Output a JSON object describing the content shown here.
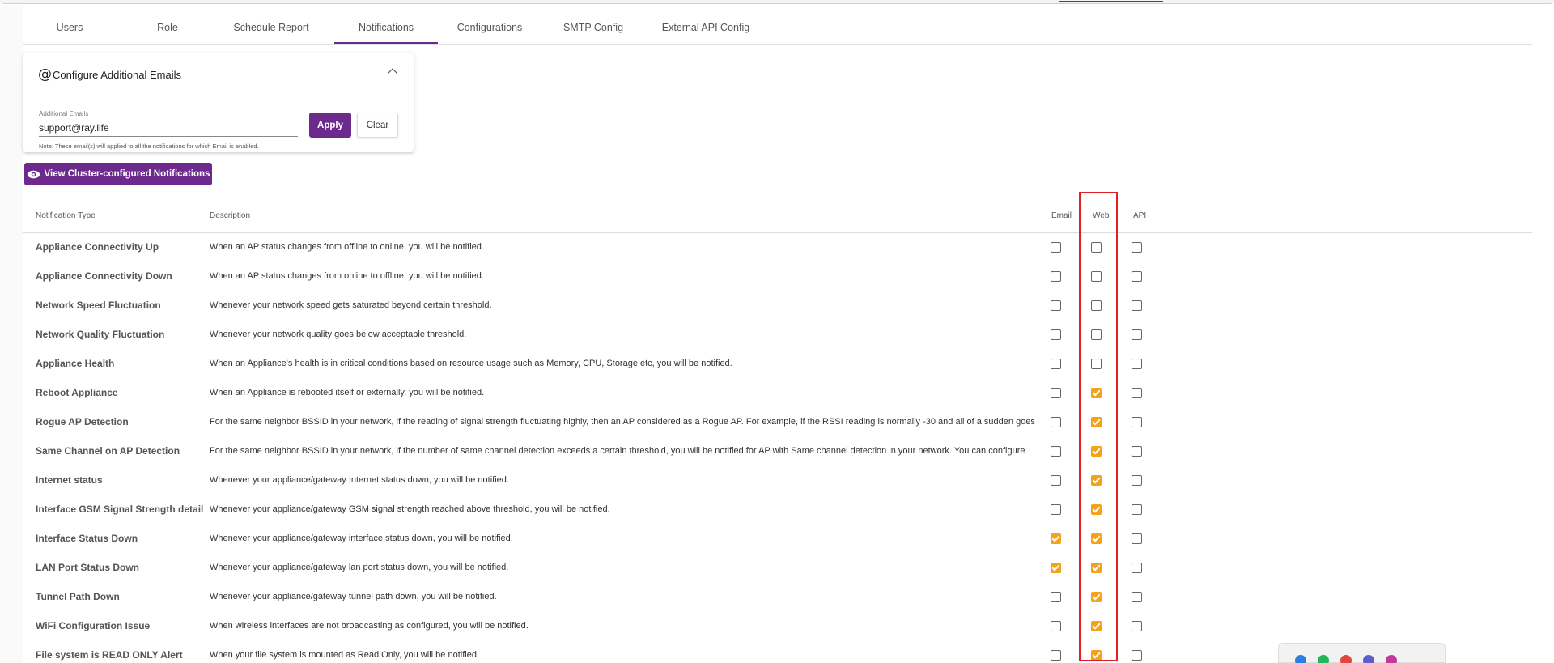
{
  "tabs": [
    {
      "label": "Users",
      "active": false
    },
    {
      "label": "Role",
      "active": false
    },
    {
      "label": "Schedule Report",
      "active": false
    },
    {
      "label": "Notifications",
      "active": true
    },
    {
      "label": "Configurations",
      "active": false
    },
    {
      "label": "SMTP Config",
      "active": false
    },
    {
      "label": "External API Config",
      "active": false
    }
  ],
  "emails_card": {
    "icon": "at-icon",
    "title": "Configure Additional Emails",
    "field_label": "Additional Emails",
    "field_value": "support@ray.life",
    "note": "Note: These email(s) will applied to all the notifications for which Email is enabled.",
    "apply_label": "Apply",
    "clear_label": "Clear"
  },
  "view_button": {
    "label": "View Cluster-configured Notifications",
    "icon": "eye-icon"
  },
  "table": {
    "headers": {
      "type": "Notification Type",
      "description": "Description",
      "email": "Email",
      "web": "Web",
      "api": "API"
    },
    "rows": [
      {
        "type": "Appliance Connectivity Up",
        "description": "When an AP status changes from offline to online, you will be notified.",
        "email": false,
        "web": false,
        "api": false
      },
      {
        "type": "Appliance Connectivity Down",
        "description": "When an AP status changes from online to offline, you will be notified.",
        "email": false,
        "web": false,
        "api": false
      },
      {
        "type": "Network Speed Fluctuation",
        "description": "Whenever your network speed gets saturated beyond certain threshold.",
        "email": false,
        "web": false,
        "api": false
      },
      {
        "type": "Network Quality Fluctuation",
        "description": "Whenever your network quality goes below acceptable threshold.",
        "email": false,
        "web": false,
        "api": false
      },
      {
        "type": "Appliance Health",
        "description": "When an Appliance's health is in critical conditions based on resource usage such as Memory, CPU, Storage etc, you will be notified.",
        "email": false,
        "web": false,
        "api": false
      },
      {
        "type": "Reboot Appliance",
        "description": "When an Appliance is rebooted itself or externally, you will be notified.",
        "email": false,
        "web": true,
        "api": false
      },
      {
        "type": "Rogue AP Detection",
        "description": "For the same neighbor BSSID in your network, if the reading of signal strength fluctuating highly, then an AP considered as a Rogue AP. For example, if the RSSI reading is normally -30 and all of a sudden goes",
        "email": false,
        "web": true,
        "api": false
      },
      {
        "type": "Same Channel on AP Detection",
        "description": "For the same neighbor BSSID in your network, if the number of same channel detection exceeds a certain threshold, you will be notified for AP with Same channel detection in your network. You can configure",
        "email": false,
        "web": true,
        "api": false
      },
      {
        "type": "Internet status",
        "description": "Whenever your appliance/gateway Internet status down, you will be notified.",
        "email": false,
        "web": true,
        "api": false
      },
      {
        "type": "Interface GSM Signal Strength detail",
        "description": "Whenever your appliance/gateway GSM signal strength reached above threshold, you will be notified.",
        "email": false,
        "web": true,
        "api": false
      },
      {
        "type": "Interface Status Down",
        "description": "Whenever your appliance/gateway interface status down, you will be notified.",
        "email": true,
        "web": true,
        "api": false
      },
      {
        "type": "LAN Port Status Down",
        "description": "Whenever your appliance/gateway lan port status down, you will be notified.",
        "email": true,
        "web": true,
        "api": false
      },
      {
        "type": "Tunnel Path Down",
        "description": "Whenever your appliance/gateway tunnel path down, you will be notified.",
        "email": false,
        "web": true,
        "api": false
      },
      {
        "type": "WiFi Configuration Issue",
        "description": "When wireless interfaces are not broadcasting as configured, you will be notified.",
        "email": false,
        "web": true,
        "api": false
      },
      {
        "type": "File system is READ ONLY Alert",
        "description": "When your file system is mounted as Read Only, you will be notified.",
        "email": false,
        "web": true,
        "api": false
      }
    ]
  },
  "colors": {
    "accent": "#6c2b8c",
    "checked": "#f5a21b",
    "highlight": "#e02020"
  }
}
